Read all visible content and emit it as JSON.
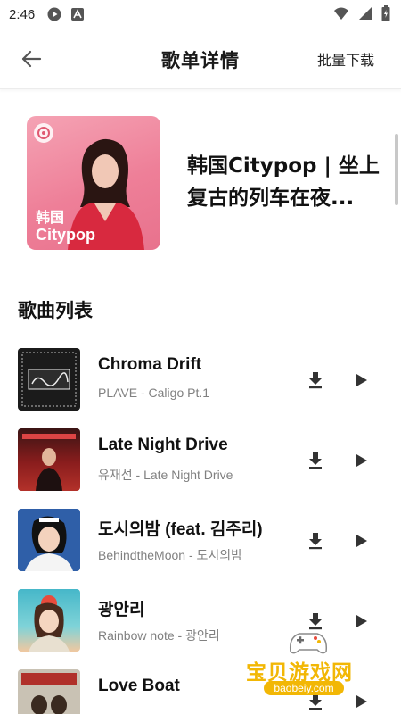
{
  "status": {
    "time": "2:46"
  },
  "header": {
    "title": "歌单详情",
    "batch_download": "批量下载"
  },
  "playlist": {
    "cover_line1": "韩国",
    "cover_line2": "Citypop",
    "title": "韩国Citypop | 坐上复古的列车在夜..."
  },
  "section": {
    "title": "歌曲列表"
  },
  "songs": [
    {
      "name": "Chroma Drift",
      "subtitle": "PLAVE - Caligo Pt.1"
    },
    {
      "name": "Late Night Drive",
      "subtitle": "유재선 - Late Night Drive"
    },
    {
      "name": "도시의밤 (feat. 김주리)",
      "subtitle": "BehindtheMoon - 도시의밤"
    },
    {
      "name": "광안리",
      "subtitle": "Rainbow note - 광안리"
    },
    {
      "name": "Love Boat",
      "subtitle": ""
    }
  ],
  "watermark": {
    "text": "宝贝游戏网",
    "url": "baobeiy.com"
  },
  "colors": {
    "accent": "#f2b705",
    "cover_pink": "#ee7f98"
  }
}
